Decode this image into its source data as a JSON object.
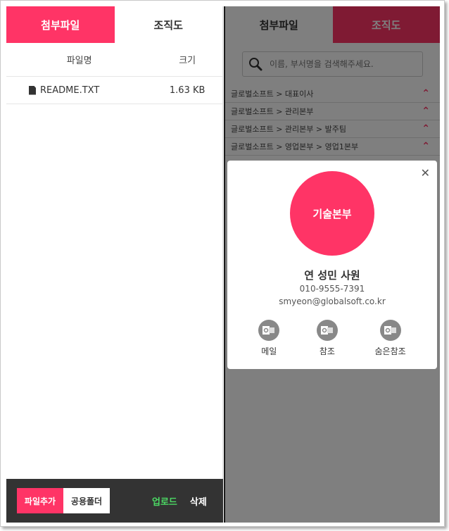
{
  "left": {
    "tabs": [
      {
        "label": "첨부파일",
        "active": true
      },
      {
        "label": "조직도",
        "active": false
      }
    ],
    "columns": {
      "name": "파일명",
      "size": "크기"
    },
    "files": [
      {
        "name": "README.TXT",
        "size": "1.63 KB"
      }
    ],
    "footer": {
      "add": "파일추가",
      "shared": "공용폴더",
      "upload": "업로드",
      "delete": "삭제"
    }
  },
  "right": {
    "tabs": [
      {
        "label": "첨부파일",
        "active": false
      },
      {
        "label": "조직도",
        "active": true
      }
    ],
    "search": {
      "placeholder": "이름, 부서명을 검색해주세요."
    },
    "org_rows": [
      "글로벌소프트 > 대표이사",
      "글로벌소프트 > 관리본부",
      "글로벌소프트 > 관리본부 > 발주팀",
      "글로벌소프트 > 영업본부 > 영업1본부"
    ],
    "popup": {
      "department": "기술본부",
      "name": "연 성민 사원",
      "phone": "010-9555-7391",
      "email": "smyeon@globalsoft.co.kr",
      "actions": [
        "메일",
        "참조",
        "숨은참조"
      ]
    }
  },
  "colors": {
    "accent": "#ff3466",
    "footer_bg": "#333333",
    "upload": "#4cd964"
  }
}
